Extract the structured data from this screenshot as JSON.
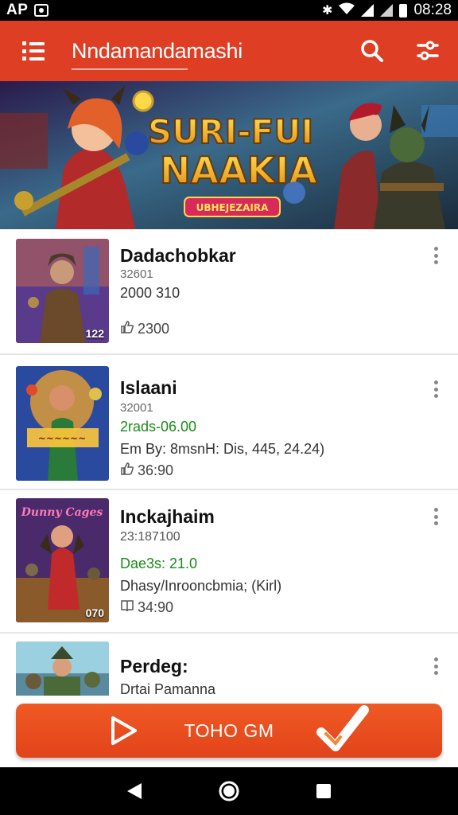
{
  "status_bar": {
    "carrier": "AP",
    "time": "08:28"
  },
  "app_bar": {
    "title": "Nndamandamashi",
    "menu_icon": "menu-icon",
    "search_icon": "search-icon",
    "filter_icon": "filter-icon"
  },
  "banner": {
    "title_line1": "SURI-FUI",
    "title_line2": "NAAKIA",
    "ribbon": "UBHEJEZAIRA"
  },
  "items": [
    {
      "title": "Dadachobkar",
      "line1": "32601",
      "line2": "2000 310",
      "likes": "2300",
      "thumb_badge": "122"
    },
    {
      "title": "Islaani",
      "line1": "32001",
      "line2": "2rads-06.00",
      "line3": "Em By: 8msnH: Dis, 445, 24.24)",
      "likes": "36:90"
    },
    {
      "title": "Inckajhaim",
      "line1": "23:187100",
      "line2": "Dae3s: 21.0",
      "line3": "Dhasy/Inrooncbmia; (Kirl)",
      "likes": "34:90",
      "thumb_badge": "070",
      "thumb_caption": "Dunny Cages"
    },
    {
      "title": "Perdeg:",
      "line1": "Drtai Pamanna"
    }
  ],
  "cta": {
    "label": "TOHO GM"
  },
  "colors": {
    "primary": "#dd3e24",
    "cta": "#e8491c",
    "green_text": "#1a8a1a"
  }
}
